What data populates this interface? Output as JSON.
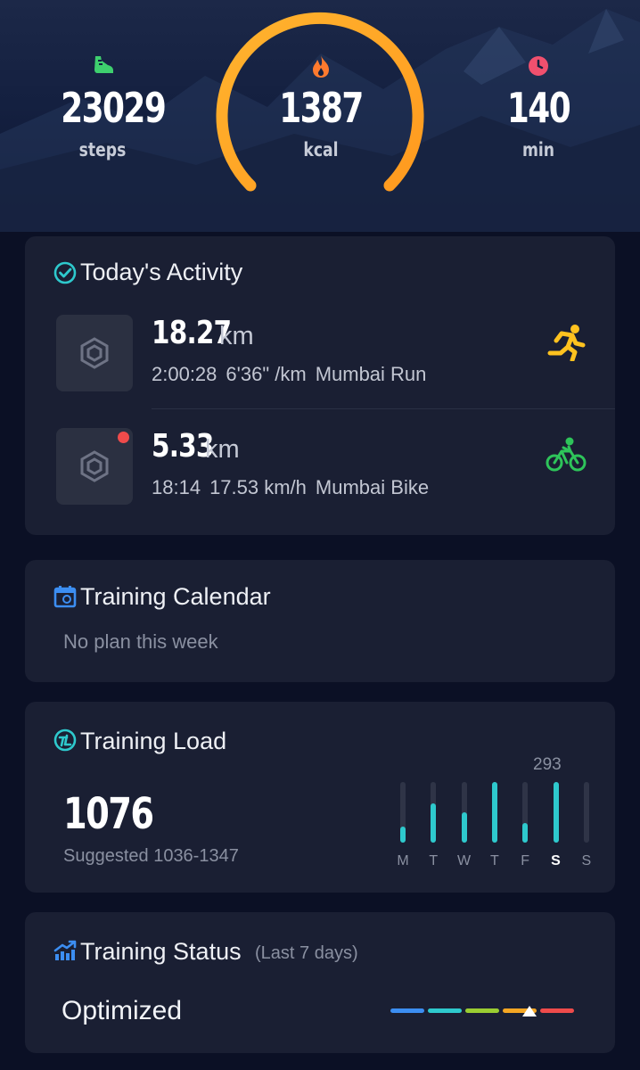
{
  "summary": {
    "steps": {
      "value": "23029",
      "unit": "steps",
      "icon": "shoe-icon",
      "color": "#3ecf6e"
    },
    "calories": {
      "value": "1387",
      "unit": "kcal",
      "icon": "flame-icon",
      "color": "#ff7a2e"
    },
    "minutes": {
      "value": "140",
      "unit": "min",
      "icon": "clock-icon",
      "color": "#f0506e"
    },
    "ring_colors": [
      "#ffb32e",
      "#ff9a1f"
    ]
  },
  "activity": {
    "title": "Today's Activity",
    "items": [
      {
        "distance": "18.27",
        "unit": "km",
        "duration": "2:00:28",
        "pace": "6'36\" /km",
        "name": "Mumbai Run",
        "type_icon": "running-icon",
        "type_color": "#ffc21f",
        "unread": false
      },
      {
        "distance": "5.33",
        "unit": "km",
        "duration": "18:14",
        "pace": "17.53 km/h",
        "name": "Mumbai Bike",
        "type_icon": "cycling-icon",
        "type_color": "#2ec45a",
        "unread": true
      }
    ]
  },
  "calendar": {
    "title": "Training Calendar",
    "message": "No plan this week"
  },
  "load": {
    "title": "Training Load",
    "value": "1076",
    "suggested": "Suggested 1036-1347",
    "peak_label": "293",
    "days": [
      "M",
      "T",
      "W",
      "T",
      "F",
      "S",
      "S"
    ],
    "day_levels": [
      0.27,
      0.64,
      0.5,
      1.0,
      0.32,
      1.0,
      0.0
    ],
    "active_day_index": 5
  },
  "status": {
    "title": "Training Status",
    "subtitle": "(Last 7 days)",
    "value": "Optimized",
    "segment_colors": [
      "#3c8ef2",
      "#2ec9cd",
      "#9acd32",
      "#f5a623",
      "#ef4b4b"
    ],
    "marker_segment": 3
  }
}
